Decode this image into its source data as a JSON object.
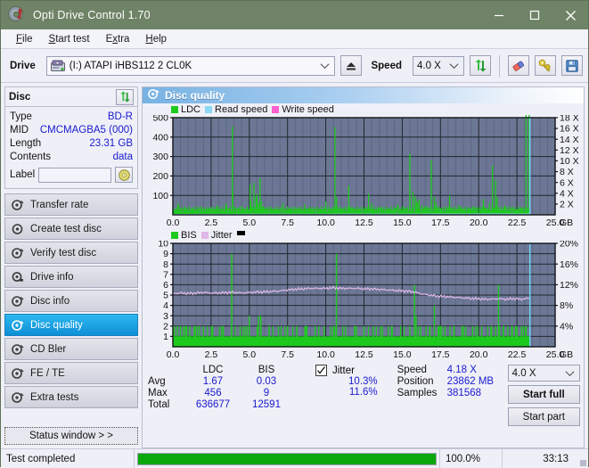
{
  "window": {
    "title": "Opti Drive Control 1.70",
    "icon": "disc-icon",
    "minimize": "minimize",
    "maximize": "maximize",
    "close": "close"
  },
  "menu": {
    "items": [
      {
        "label": "File",
        "accel": "F"
      },
      {
        "label": "Start test",
        "accel": "S"
      },
      {
        "label": "Extra",
        "accel": "x"
      },
      {
        "label": "Help",
        "accel": "H"
      }
    ]
  },
  "toolbar": {
    "drive_label": "Drive",
    "drive_value": "(I:)  ATAPI iHBS112  2 CL0K",
    "eject_label": "Eject",
    "speed_label": "Speed",
    "speed_value": "4.0 X",
    "refresh_label": "Refresh",
    "erase_label": "Erase",
    "tools_label": "Tools",
    "save_label": "Save"
  },
  "disc": {
    "header": "Disc",
    "refresh_label": "Refresh disc info",
    "rows": [
      {
        "key": "Type",
        "value": "BD-R"
      },
      {
        "key": "MID",
        "value": "CMCMAGBA5 (000)"
      },
      {
        "key": "Length",
        "value": "23.31 GB"
      },
      {
        "key": "Contents",
        "value": "data"
      }
    ],
    "label_key": "Label",
    "label_value": "",
    "label_placeholder": "",
    "label_button": "Set label"
  },
  "nav": {
    "items": [
      {
        "label": "Transfer rate",
        "selected": false
      },
      {
        "label": "Create test disc",
        "selected": false
      },
      {
        "label": "Verify test disc",
        "selected": false
      },
      {
        "label": "Drive info",
        "selected": false
      },
      {
        "label": "Disc info",
        "selected": false
      },
      {
        "label": "Disc quality",
        "selected": true
      },
      {
        "label": "CD Bler",
        "selected": false
      },
      {
        "label": "FE / TE",
        "selected": false
      },
      {
        "label": "Extra tests",
        "selected": false
      }
    ],
    "status_window": "Status window > >"
  },
  "panel": {
    "title": "Disc quality",
    "icon": "disc-quality-icon"
  },
  "colors": {
    "titlebar": "#6f8366",
    "plot_bg": "#6b7794",
    "grid": "#2b2f3c",
    "ldc_green": "#1ec91e",
    "read_speed_blue": "#8cd8f5",
    "write_speed_pink": "#ff60d0",
    "jitter_pink": "#e0b8e8",
    "accent_blue": "#1919cf",
    "progress_green": "#0aa80a",
    "selected_nav": "#0d8fd6"
  },
  "chart_data": [
    {
      "type": "line",
      "name": "ldc-chart",
      "title": "",
      "xlabel": "GB",
      "ylabel": "LDC",
      "legend": [
        {
          "label": "LDC",
          "color": "#1ec91e"
        },
        {
          "label": "Read speed",
          "color": "#8cd8f5"
        },
        {
          "label": "Write speed",
          "color": "#ff60d0"
        }
      ],
      "legend_position": "top-left",
      "grid": true,
      "xlim": [
        0,
        25
      ],
      "xticks": [
        "0.0",
        "2.5",
        "5.0",
        "7.5",
        "10.0",
        "12.5",
        "15.0",
        "17.5",
        "20.0",
        "22.5",
        "25.0"
      ],
      "x_unit": "GB",
      "ylim": [
        0,
        500
      ],
      "yticks": [
        "100",
        "200",
        "300",
        "400",
        "500"
      ],
      "y2lim": [
        0,
        18
      ],
      "y2ticks": [
        "2 X",
        "4 X",
        "6 X",
        "8 X",
        "10 X",
        "12 X",
        "14 X",
        "16 X",
        "18 X"
      ],
      "series": [
        {
          "name": "LDC",
          "color": "#1ec91e",
          "type": "impulse",
          "x": [
            0.05,
            0.2,
            0.35,
            0.5,
            0.65,
            0.8,
            0.95,
            1.1,
            1.3,
            1.5,
            1.7,
            1.9,
            2.1,
            2.3,
            2.5,
            2.7,
            2.9,
            3.1,
            3.3,
            3.5,
            3.7,
            3.9,
            3.92,
            4.1,
            4.3,
            4.5,
            4.7,
            4.9,
            5.05,
            5.1,
            5.2,
            5.3,
            5.45,
            5.5,
            5.6,
            5.7,
            5.8,
            5.9,
            6.0,
            6.2,
            6.4,
            6.6,
            6.8,
            7.0,
            7.2,
            7.4,
            7.6,
            7.8,
            8.0,
            8.2,
            8.4,
            8.6,
            8.8,
            9.0,
            9.2,
            9.4,
            9.6,
            9.8,
            10.0,
            10.2,
            10.4,
            10.6,
            10.7,
            10.9,
            11.1,
            11.3,
            11.5,
            11.7,
            11.9,
            12.0,
            12.2,
            12.4,
            12.6,
            12.8,
            13.0,
            13.1,
            13.3,
            13.5,
            13.7,
            13.9,
            14.1,
            14.3,
            14.5,
            14.7,
            14.9,
            15.1,
            15.3,
            15.5,
            15.7,
            15.85,
            15.95,
            16.0,
            16.1,
            16.3,
            16.5,
            16.7,
            16.9,
            17.1,
            17.2,
            17.3,
            17.5,
            17.7,
            17.9,
            18.1,
            18.3,
            18.5,
            18.7,
            18.9,
            19.1,
            19.3,
            19.5,
            19.7,
            19.9,
            20.1,
            20.3,
            20.5,
            20.7,
            20.9,
            21.1,
            21.2,
            21.3,
            21.5,
            21.7,
            21.9,
            22.1,
            22.3,
            22.5,
            22.7,
            22.9,
            23.1,
            23.3
          ],
          "y": [
            15,
            25,
            60,
            20,
            18,
            35,
            22,
            25,
            30,
            18,
            40,
            22,
            28,
            20,
            35,
            25,
            50,
            22,
            28,
            60,
            30,
            455,
            120,
            30,
            25,
            45,
            20,
            28,
            155,
            70,
            40,
            165,
            90,
            110,
            60,
            190,
            70,
            45,
            30,
            25,
            40,
            22,
            28,
            20,
            60,
            25,
            30,
            22,
            35,
            20,
            28,
            55,
            25,
            30,
            22,
            40,
            25,
            28,
            70,
            30,
            25,
            450,
            90,
            35,
            28,
            25,
            150,
            40,
            25,
            30,
            28,
            22,
            35,
            110,
            60,
            30,
            25,
            40,
            28,
            22,
            35,
            25,
            30,
            55,
            25,
            40,
            28,
            315,
            120,
            95,
            70,
            60,
            80,
            50,
            45,
            40,
            280,
            95,
            60,
            40,
            30,
            25,
            40,
            100,
            35,
            28,
            50,
            30,
            22,
            35,
            28,
            40,
            25,
            30,
            80,
            35,
            60,
            255,
            180,
            90,
            40,
            30,
            50,
            25,
            40,
            30,
            25,
            35,
            20
          ]
        },
        {
          "name": "Read speed",
          "color": "#8cd8f5",
          "type": "line",
          "x": [
            0.0,
            1.0,
            2.0,
            3.0,
            4.0,
            5.0,
            6.0,
            7.0,
            8.0,
            9.0,
            10.0,
            11.0,
            12.0,
            13.0,
            14.0,
            15.0,
            16.0,
            17.0,
            18.0,
            19.0,
            20.0,
            21.0,
            22.0,
            23.0,
            23.3,
            23.35
          ],
          "y": [
            1.9,
            2.3,
            2.45,
            2.55,
            2.65,
            2.8,
            3.0,
            3.05,
            3.1,
            3.15,
            3.2,
            3.3,
            3.4,
            3.5,
            3.55,
            3.65,
            3.75,
            3.85,
            4.0,
            4.0,
            4.1,
            4.1,
            4.15,
            4.2,
            4.2,
            18.0
          ]
        },
        {
          "name": "Write speed",
          "color": "#ff60d0",
          "type": "line",
          "x": [],
          "y": []
        }
      ],
      "annotations": {
        "end_marker_x": 23.35,
        "end_marker_color": "#6fd8f8"
      }
    },
    {
      "type": "line",
      "name": "bis-chart",
      "title": "",
      "xlabel": "GB",
      "ylabel": "BIS",
      "legend": [
        {
          "label": "BIS",
          "color": "#1ec91e"
        },
        {
          "label": "Jitter",
          "color": "#e0b8e8"
        },
        {
          "label": "",
          "color": "#000000"
        }
      ],
      "legend_position": "top-left",
      "grid": true,
      "xlim": [
        0,
        25
      ],
      "xticks": [
        "0.0",
        "2.5",
        "5.0",
        "7.5",
        "10.0",
        "12.5",
        "15.0",
        "17.5",
        "20.0",
        "22.5",
        "25.0"
      ],
      "x_unit": "GB",
      "ylim": [
        0,
        10
      ],
      "yticks": [
        "1",
        "2",
        "3",
        "4",
        "5",
        "6",
        "7",
        "8",
        "9",
        "10"
      ],
      "y2lim": [
        0,
        20
      ],
      "y2ticks": [
        "4%",
        "8%",
        "12%",
        "16%",
        "20%"
      ],
      "series": [
        {
          "name": "BIS",
          "color": "#1ec91e",
          "type": "impulse-filled",
          "baseline": 1,
          "x": [
            0.1,
            0.3,
            0.5,
            0.7,
            0.9,
            1.1,
            1.4,
            1.7,
            2.0,
            2.3,
            2.6,
            2.9,
            3.2,
            3.5,
            3.85,
            4.1,
            4.4,
            4.7,
            5.0,
            5.3,
            5.6,
            5.75,
            6.0,
            6.3,
            6.6,
            6.9,
            7.2,
            7.5,
            7.8,
            8.1,
            8.4,
            8.7,
            9.0,
            9.3,
            9.6,
            9.9,
            10.2,
            10.5,
            10.7,
            11.0,
            11.3,
            11.6,
            11.9,
            12.2,
            12.5,
            12.8,
            13.1,
            13.4,
            13.7,
            14.0,
            14.3,
            14.6,
            14.9,
            15.2,
            15.5,
            15.8,
            15.9,
            16.2,
            16.5,
            16.8,
            17.1,
            17.4,
            17.5,
            17.8,
            18.1,
            18.4,
            18.7,
            19.0,
            19.3,
            19.6,
            19.9,
            20.2,
            20.5,
            20.8,
            21.1,
            21.3,
            21.6,
            21.9,
            22.2,
            22.5,
            22.8,
            23.1,
            23.3
          ],
          "y": [
            2,
            2,
            2,
            2,
            2,
            2,
            2,
            1,
            2,
            1,
            2,
            1,
            2,
            1,
            9,
            1,
            2,
            1,
            3,
            1,
            3,
            3,
            1,
            2,
            1,
            2,
            1,
            2,
            1,
            2,
            1,
            2,
            1,
            2,
            1,
            2,
            1,
            2,
            9,
            1,
            2,
            1,
            2,
            1,
            2,
            1,
            2,
            1,
            2,
            1,
            2,
            1,
            2,
            1,
            2,
            6,
            3,
            2,
            1,
            2,
            4,
            2,
            2,
            2,
            1,
            2,
            1,
            2,
            1,
            2,
            1,
            2,
            1,
            2,
            2,
            6,
            2,
            2,
            2,
            2,
            2,
            2,
            1
          ]
        },
        {
          "name": "Jitter",
          "color": "#e0b8e8",
          "type": "line",
          "axis": "right",
          "x": [
            0.0,
            0.5,
            1.0,
            1.5,
            2.0,
            2.5,
            3.0,
            3.5,
            4.0,
            4.5,
            5.0,
            5.5,
            6.0,
            6.5,
            7.0,
            7.5,
            8.0,
            8.5,
            9.0,
            9.5,
            10.0,
            10.5,
            11.0,
            11.5,
            12.0,
            12.5,
            13.0,
            13.5,
            14.0,
            14.5,
            15.0,
            15.5,
            15.9,
            16.3,
            16.8,
            17.3,
            17.8,
            18.3,
            18.8,
            19.3,
            19.8,
            20.3,
            20.8,
            21.3,
            21.8,
            22.3,
            22.8,
            23.3
          ],
          "y": [
            10.3,
            10.4,
            10.3,
            10.4,
            10.5,
            10.4,
            10.4,
            10.5,
            10.5,
            10.4,
            10.5,
            10.6,
            10.6,
            10.7,
            10.8,
            11.0,
            11.1,
            11.2,
            11.3,
            11.3,
            11.3,
            11.4,
            11.3,
            11.3,
            11.3,
            11.2,
            11.2,
            11.1,
            11.0,
            10.9,
            10.8,
            10.7,
            10.5,
            10.2,
            10.0,
            9.8,
            9.7,
            9.6,
            9.5,
            9.4,
            9.3,
            9.2,
            9.2,
            9.3,
            9.2,
            9.3,
            9.2,
            9.4
          ]
        }
      ],
      "annotations": {
        "end_marker_x": 23.35,
        "end_marker_color": "#6fd8f8"
      }
    }
  ],
  "stats": {
    "col_headers": [
      "",
      "LDC",
      "BIS"
    ],
    "rows": [
      {
        "label": "Avg",
        "ldc": "1.67",
        "bis": "0.03"
      },
      {
        "label": "Max",
        "ldc": "456",
        "bis": "9"
      },
      {
        "label": "Total",
        "ldc": "636677",
        "bis": "12591"
      }
    ],
    "jitter": {
      "label": "Jitter",
      "checked": true,
      "avg": "10.3%",
      "max": "11.6%"
    },
    "right": [
      {
        "key": "Speed",
        "value": "4.18 X"
      },
      {
        "key": "Position",
        "value": "23862 MB"
      },
      {
        "key": "Samples",
        "value": "381568"
      }
    ],
    "speed_select": "4.0 X",
    "start_full": "Start full",
    "start_part": "Start part"
  },
  "statusbar": {
    "message": "Test completed",
    "progress_percent": 100,
    "percent_text": "100.0%",
    "time": "33:13"
  }
}
